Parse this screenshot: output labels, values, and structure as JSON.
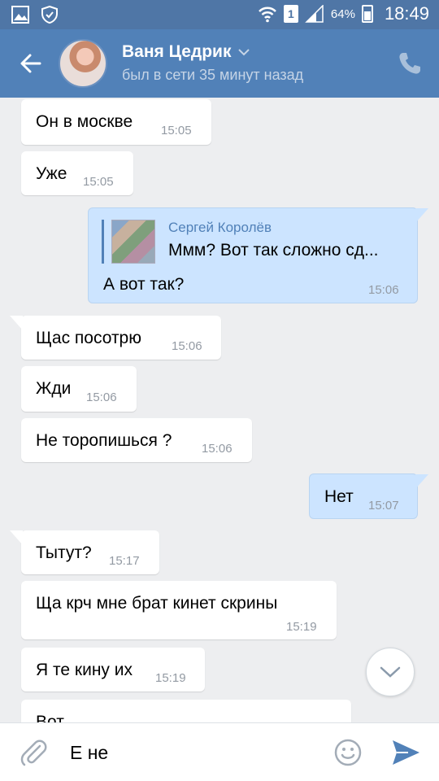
{
  "statusbar": {
    "battery": "64%",
    "time": "18:49",
    "sim": "1",
    "icons": [
      "gallery-icon",
      "shield-icon",
      "wifi-icon",
      "signal-icon",
      "battery-icon"
    ]
  },
  "header": {
    "name": "Ваня Цедрик",
    "status": "был в сети 35 минут назад",
    "icons": [
      "back-arrow-icon",
      "chevron-down-icon",
      "phone-icon"
    ]
  },
  "messages": [
    {
      "dir": "in",
      "text": "Он в москве",
      "time": "15:05"
    },
    {
      "dir": "in",
      "text": "Уже",
      "time": "15:05"
    },
    {
      "dir": "out",
      "reply_author": "Сергей Королёв",
      "reply_text": "Ммм? Вот так сложно сд...",
      "text": "А вот так?",
      "time": "15:06"
    },
    {
      "dir": "in",
      "text": "Щас посотрю",
      "time": "15:06"
    },
    {
      "dir": "in",
      "text": "Жди",
      "time": "15:06"
    },
    {
      "dir": "in",
      "text": "Не торопишься ?",
      "time": "15:06"
    },
    {
      "dir": "out",
      "text": "Нет",
      "time": "15:07"
    },
    {
      "dir": "in",
      "text": "Тытут?",
      "time": "15:17"
    },
    {
      "dir": "in",
      "text": "Ща крч мне брат кинет скрины",
      "time": "15:19"
    },
    {
      "dir": "in",
      "text": "Я те кину их",
      "time": "15:19"
    },
    {
      "dir": "in",
      "text": "Вот",
      "time": ""
    }
  ],
  "composer": {
    "value": "Е не",
    "icons": [
      "paperclip-icon",
      "emoji-icon",
      "send-icon"
    ]
  },
  "colors": {
    "header": "#5181b8",
    "statusbar": "#4f76a6",
    "background": "#edeef0",
    "outgoing_bubble": "#cce4ff",
    "incoming_bubble": "#ffffff",
    "accent": "#5181b8"
  }
}
